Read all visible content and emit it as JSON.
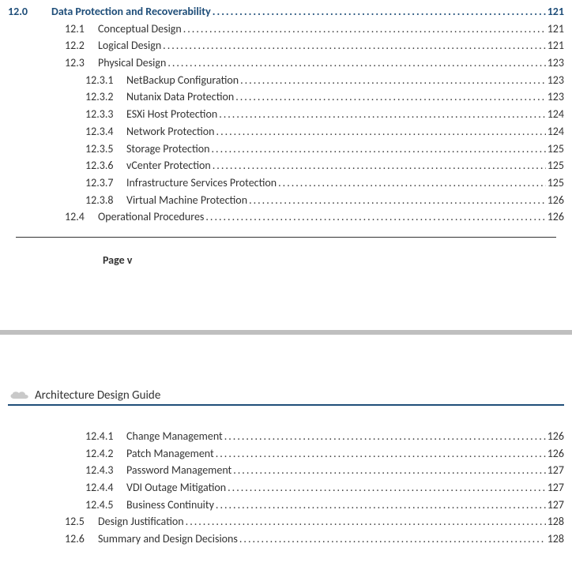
{
  "page_footer": "Page v",
  "doc_header": "Architecture Design Guide",
  "icons": {
    "cloud": "cloud-icon"
  },
  "toc_top": [
    {
      "level": 0,
      "num": "12.0",
      "title": "Data Protection and Recoverability",
      "page": "121"
    },
    {
      "level": 1,
      "num": "12.1",
      "title": "Conceptual Design",
      "page": "121"
    },
    {
      "level": 1,
      "num": "12.2",
      "title": "Logical Design",
      "page": "121"
    },
    {
      "level": 1,
      "num": "12.3",
      "title": "Physical Design",
      "page": "123"
    },
    {
      "level": 2,
      "num": "12.3.1",
      "title": "NetBackup Configuration",
      "page": "123"
    },
    {
      "level": 2,
      "num": "12.3.2",
      "title": "Nutanix Data Protection",
      "page": "123"
    },
    {
      "level": 2,
      "num": "12.3.3",
      "title": "ESXi Host Protection",
      "page": "124"
    },
    {
      "level": 2,
      "num": "12.3.4",
      "title": "Network Protection",
      "page": "124"
    },
    {
      "level": 2,
      "num": "12.3.5",
      "title": "Storage Protection",
      "page": "125"
    },
    {
      "level": 2,
      "num": "12.3.6",
      "title": "vCenter Protection",
      "page": "125"
    },
    {
      "level": 2,
      "num": "12.3.7",
      "title": "Infrastructure Services Protection",
      "page": "125"
    },
    {
      "level": 2,
      "num": "12.3.8",
      "title": "Virtual Machine Protection",
      "page": "126"
    },
    {
      "level": 1,
      "num": "12.4",
      "title": "Operational Procedures",
      "page": "126"
    }
  ],
  "toc_bottom": [
    {
      "level": 2,
      "num": "12.4.1",
      "title": "Change Management",
      "page": "126"
    },
    {
      "level": 2,
      "num": "12.4.2",
      "title": "Patch Management",
      "page": "126"
    },
    {
      "level": 2,
      "num": "12.4.3",
      "title": "Password Management",
      "page": "127"
    },
    {
      "level": 2,
      "num": "12.4.4",
      "title": "VDI Outage Mitigation",
      "page": "127"
    },
    {
      "level": 2,
      "num": "12.4.5",
      "title": "Business Continuity",
      "page": "127"
    },
    {
      "level": 1,
      "num": "12.5",
      "title": "Design Justification",
      "page": "128"
    },
    {
      "level": 1,
      "num": "12.6",
      "title": "Summary and Design Decisions",
      "page": "128"
    }
  ]
}
